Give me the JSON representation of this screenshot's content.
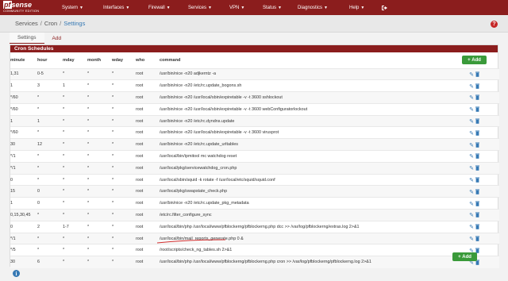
{
  "logo": {
    "brand": "sense",
    "brand_prefix": "pf",
    "edition": "COMMUNITY EDITION"
  },
  "nav": [
    {
      "label": "System"
    },
    {
      "label": "Interfaces"
    },
    {
      "label": "Firewall"
    },
    {
      "label": "Services"
    },
    {
      "label": "VPN"
    },
    {
      "label": "Status"
    },
    {
      "label": "Diagnostics"
    },
    {
      "label": "Help"
    }
  ],
  "breadcrumb": {
    "part1": "Services",
    "part2": "Cron",
    "part3": "Settings"
  },
  "help_icon": "?",
  "tabs": {
    "settings": "Settings",
    "add": "Add"
  },
  "panel": {
    "title": "Cron Schedules"
  },
  "columns": {
    "minute": "minute",
    "hour": "hour",
    "mday": "mday",
    "month": "month",
    "wday": "wday",
    "who": "who",
    "command": "command"
  },
  "add_button": "Add",
  "rows": [
    [
      "1,31",
      "0-5",
      "*",
      "*",
      "*",
      "root",
      "/usr/bin/nice -n20 adjkerntz -a"
    ],
    [
      "1",
      "3",
      "1",
      "*",
      "*",
      "root",
      "/usr/bin/nice -n20 /etc/rc.update_bogons.sh"
    ],
    [
      "*/60",
      "*",
      "*",
      "*",
      "*",
      "root",
      "/usr/bin/nice -n20 /usr/local/sbin/expiretable -v -t 3600 sshlockout"
    ],
    [
      "*/60",
      "*",
      "*",
      "*",
      "*",
      "root",
      "/usr/bin/nice -n20 /usr/local/sbin/expiretable -v -t 3600 webConfiguratorlockout"
    ],
    [
      "1",
      "1",
      "*",
      "*",
      "*",
      "root",
      "/usr/bin/nice -n20 /etc/rc.dyndns.update"
    ],
    [
      "*/60",
      "*",
      "*",
      "*",
      "*",
      "root",
      "/usr/bin/nice -n20 /usr/local/sbin/expiretable -v -t 3600 virusprot"
    ],
    [
      "30",
      "12",
      "*",
      "*",
      "*",
      "root",
      "/usr/bin/nice -n20 /etc/rc.update_urltables"
    ],
    [
      "*/1",
      "*",
      "*",
      "*",
      "*",
      "root",
      "/usr/local/bin/ipmitool mc watchdog reset"
    ],
    [
      "*/1",
      "*",
      "*",
      "*",
      "*",
      "root",
      "/usr/local/pkg/servicewatchdog_cron.php"
    ],
    [
      "0",
      "*",
      "*",
      "*",
      "*",
      "root",
      "/usr/local/sbin/squid -k rotate -f /usr/local/etc/squid/squid.conf"
    ],
    [
      "15",
      "0",
      "*",
      "*",
      "*",
      "root",
      "/usr/local/pkg/swapstate_check.php"
    ],
    [
      "1",
      "0",
      "*",
      "*",
      "*",
      "root",
      "/usr/bin/nice -n20 /etc/rc.update_pkg_metadata"
    ],
    [
      "0,15,30,45",
      "*",
      "*",
      "*",
      "*",
      "root",
      "/etc/rc.filter_configure_sync"
    ],
    [
      "0",
      "2",
      "1-7",
      "*",
      "*",
      "root",
      "/usr/local/bin/php /usr/local/www/pfblockerng/pfblockerng.php dcc >> /var/log/pfblockerng/extras.log 2>&1"
    ],
    [
      "*/1",
      "*",
      "*",
      "*",
      "*",
      "root",
      "/usr/local/bin/mail_reports_generate.php 0 &"
    ],
    [
      "*/5",
      "*",
      "*",
      "*",
      "*",
      "root",
      "/root/scripts/check_ng_tables.sh 2>&1"
    ],
    [
      "30",
      "6",
      "*",
      "*",
      "*",
      "root",
      "/usr/local/bin/php /usr/local/www/pfblockerng/pfblockerng.php cron >> /var/log/pfblockerng/pfblockerng.log 2>&1"
    ]
  ],
  "info_icon": "i",
  "colors": {
    "brand": "#8b1d1d",
    "add_button": "#3a9a3a",
    "link": "#3679b4",
    "annotation": "#d32f2f"
  }
}
